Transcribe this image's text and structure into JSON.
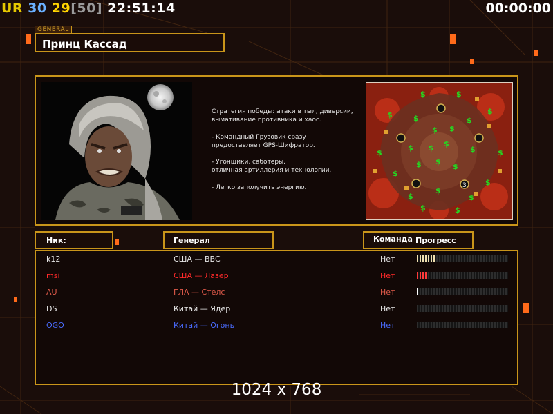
{
  "hud": {
    "ur_label": "UR",
    "fps": "30",
    "fps_target": "29",
    "limit": "[50]",
    "system_time": "22:51:14",
    "game_timer": "00:00:00"
  },
  "general": {
    "tag": "GENERAL",
    "name": "Принц Кассад",
    "strategy_text": "Стратегия победы: атаки в тыл, диверсии,\n вымативание противника и хаос.\n\n- Командный Грузовик сразу\nпредоставляет GPS-Шифратор.\n\n- Угонщики, саботёры,\nотличная артиллерия и технологии.\n\n- Легко заполучить энергию.",
    "portrait_icon": "soldier-portrait-icon",
    "map_icon": "minimap-icon"
  },
  "headers": {
    "nick": "Ник:",
    "general": "Генерал",
    "team": "Команда",
    "progress": "Прогресс"
  },
  "players": [
    {
      "nick": "k12",
      "general": "США — ВВС",
      "team": "Нет",
      "color": "#e6e6e6",
      "fill_color": "#f0e0b0",
      "progress": 0.2
    },
    {
      "nick": "msi",
      "general": "США — Лазер",
      "team": "Нет",
      "color": "#ff2a2a",
      "fill_color": "#ff3a3a",
      "progress": 0.11
    },
    {
      "nick": "AU",
      "general": "ГЛА — Стелс",
      "team": "Нет",
      "color": "#e05a4a",
      "fill_color": "#ffffff",
      "progress": 0.02
    },
    {
      "nick": "DS",
      "general": "Китай — Ядер",
      "team": "Нет",
      "color": "#e6e6e6",
      "fill_color": "#e6e6e6",
      "progress": 0
    },
    {
      "nick": "OGO",
      "general": "Китай — Огонь",
      "team": "Нет",
      "color": "#4a6cff",
      "fill_color": "#4a6cff",
      "progress": 0
    }
  ],
  "resolution": "1024 x 768",
  "colors": {
    "accent_gold": "#c9951a",
    "ur_yellow": "#e6c800",
    "fps_blue": "#6ab0ff",
    "fps_target_yellow": "#ffd400",
    "limit_gray": "#9a9a9a"
  }
}
